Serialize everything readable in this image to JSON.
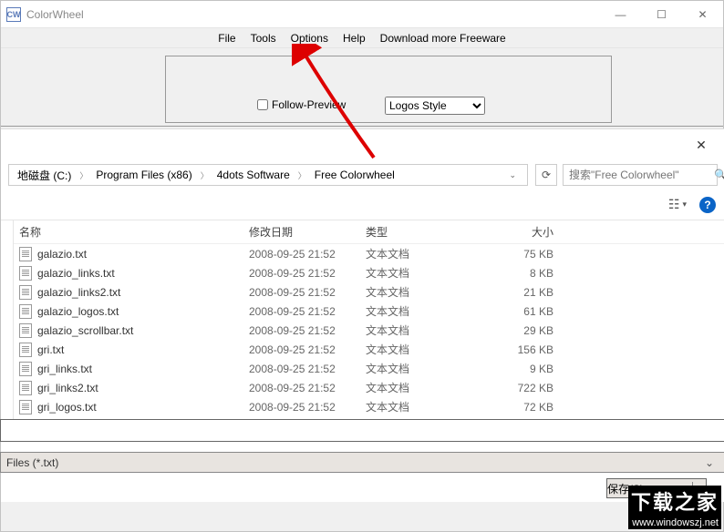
{
  "app": {
    "title": "ColorWheel",
    "icon_text": "CW"
  },
  "win_controls": {
    "min": "—",
    "max": "☐",
    "close": "✕"
  },
  "menu": {
    "file": "File",
    "tools": "Tools",
    "options": "Options",
    "help": "Help",
    "download": "Download more Freeware"
  },
  "toolbar": {
    "follow_label": "Follow-Preview",
    "style_value": "Logos Style"
  },
  "dialog": {
    "close_glyph": "✕",
    "breadcrumb": {
      "seg1": "地磁盘 (C:)",
      "seg2": "Program Files (x86)",
      "seg3": "4dots Software",
      "seg4": "Free Colorwheel"
    },
    "search_placeholder": "搜索\"Free Colorwheel\"",
    "refresh_glyph": "⟳",
    "view_glyph": "☷",
    "help_glyph": "?",
    "columns": {
      "name": "名称",
      "date": "修改日期",
      "type": "类型",
      "size": "大小"
    },
    "files": [
      {
        "name": "galazio.txt",
        "date": "2008-09-25 21:52",
        "type": "文本文档",
        "size": "75 KB"
      },
      {
        "name": "galazio_links.txt",
        "date": "2008-09-25 21:52",
        "type": "文本文档",
        "size": "8 KB"
      },
      {
        "name": "galazio_links2.txt",
        "date": "2008-09-25 21:52",
        "type": "文本文档",
        "size": "21 KB"
      },
      {
        "name": "galazio_logos.txt",
        "date": "2008-09-25 21:52",
        "type": "文本文档",
        "size": "61 KB"
      },
      {
        "name": "galazio_scrollbar.txt",
        "date": "2008-09-25 21:52",
        "type": "文本文档",
        "size": "29 KB"
      },
      {
        "name": "gri.txt",
        "date": "2008-09-25 21:52",
        "type": "文本文档",
        "size": "156 KB"
      },
      {
        "name": "gri_links.txt",
        "date": "2008-09-25 21:52",
        "type": "文本文档",
        "size": "9 KB"
      },
      {
        "name": "gri_links2.txt",
        "date": "2008-09-25 21:52",
        "type": "文本文档",
        "size": "722 KB"
      },
      {
        "name": "gri_logos.txt",
        "date": "2008-09-25 21:52",
        "type": "文本文档",
        "size": "72 KB"
      }
    ],
    "filter_label": "Files (*.txt)",
    "save_label": "保存(S)"
  },
  "watermark": {
    "cn": "下载之家",
    "url": "www.windowszj.net"
  }
}
